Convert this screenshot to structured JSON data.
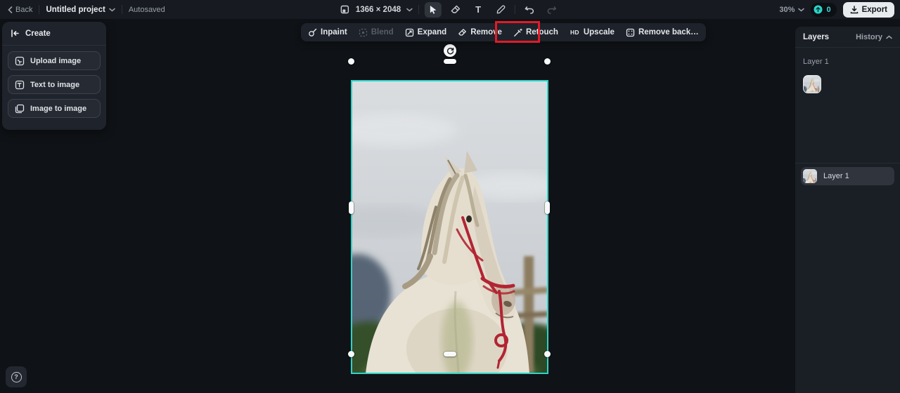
{
  "topbar": {
    "back_label": "Back",
    "project_name": "Untitled project",
    "autosave_status": "Autosaved",
    "canvas_size": "1366 × 2048",
    "zoom_level": "30%",
    "credits_count": "0",
    "export_label": "Export"
  },
  "tools": {
    "text_tool_glyph": "T"
  },
  "create_panel": {
    "title": "Create",
    "items": [
      {
        "label": "Upload image"
      },
      {
        "label": "Text to image"
      },
      {
        "label": "Image to image"
      }
    ]
  },
  "edit_toolbar": {
    "inpaint": "Inpaint",
    "blend": "Blend",
    "expand": "Expand",
    "remove": "Remove",
    "retouch": "Retouch",
    "upscale_prefix": "HD",
    "upscale": "Upscale",
    "remove_background": "Remove back…"
  },
  "layers_panel": {
    "title": "Layers",
    "history_label": "History",
    "history_item_label": "Layer 1",
    "layer_row_label": "Layer 1"
  },
  "help": {
    "glyph": "?"
  },
  "colors": {
    "accent_teal": "#2bd4c8",
    "annotation_red": "#e01b29",
    "export_bg": "#e8ebee"
  }
}
